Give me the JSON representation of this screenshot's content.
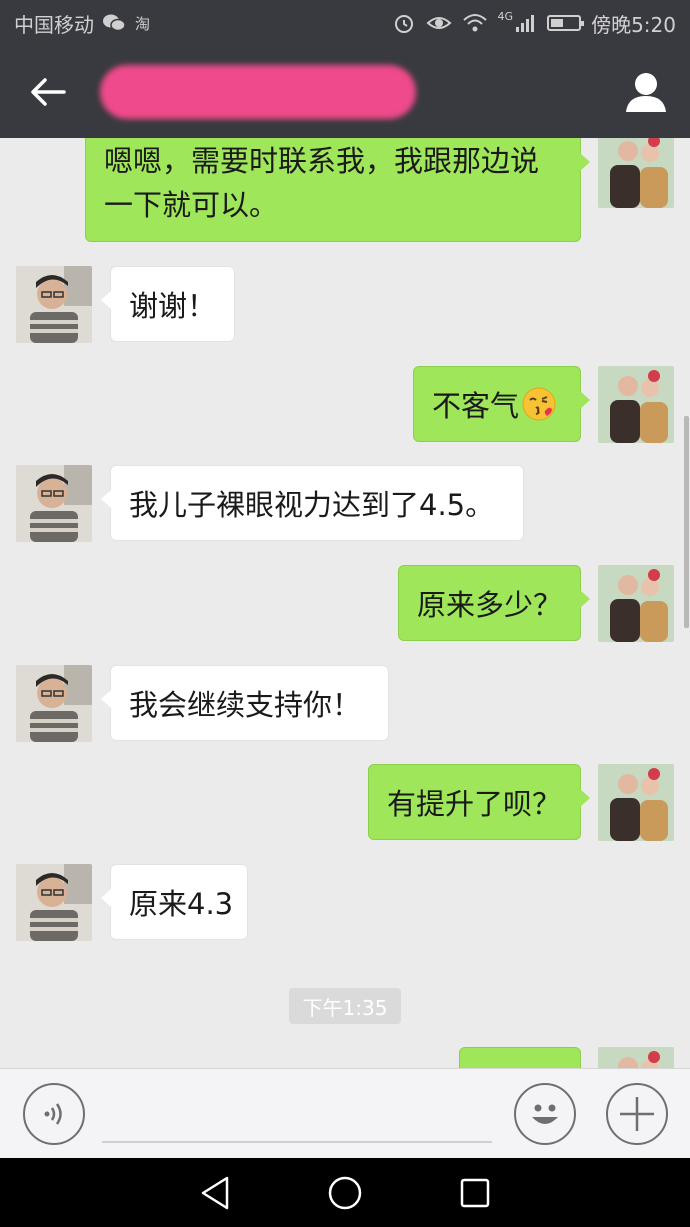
{
  "status_bar": {
    "carrier": "中国移动",
    "network": "4G",
    "battery_level": 0.45,
    "time": "傍晚5:20"
  },
  "title_bar": {
    "title": ""
  },
  "messages": [
    {
      "side": "right",
      "text": "嗯嗯，需要时联系我，我跟那边说一下就可以。"
    },
    {
      "side": "left",
      "text": "谢谢！"
    },
    {
      "side": "right",
      "text": "不客气",
      "emoji": "kissing-face-emoji"
    },
    {
      "side": "left",
      "text": "我儿子裸眼视力达到了4.5。"
    },
    {
      "side": "right",
      "text": "原来多少？"
    },
    {
      "side": "left",
      "text": "我会继续支持你！"
    },
    {
      "side": "right",
      "text": "有提升了呗？"
    },
    {
      "side": "left",
      "text": "原来4.3"
    },
    {
      "side": "right",
      "text": ""
    }
  ],
  "timestamp": "下午1:35",
  "input_bar": {
    "voice_icon": "voice-icon",
    "emoji_icon": "emoji-icon",
    "plus_icon": "plus-icon"
  },
  "nav_bar": {
    "back_icon": "back-triangle-icon",
    "home_icon": "home-circle-icon",
    "recent_icon": "recent-square-icon"
  }
}
